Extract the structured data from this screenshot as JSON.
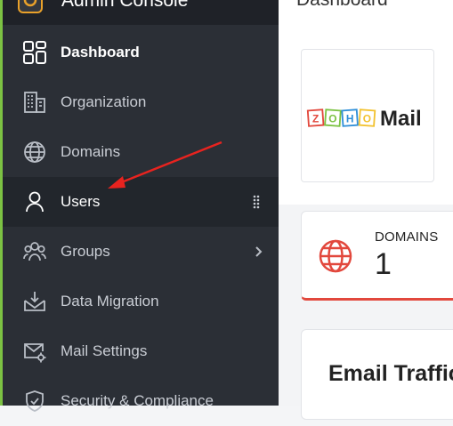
{
  "app": {
    "title": "Admin Console"
  },
  "header": {
    "title": "Dashboard"
  },
  "sidebar": {
    "items": [
      {
        "label": "Dashboard",
        "icon": "dashboard-icon",
        "active": true
      },
      {
        "label": "Organization",
        "icon": "building-icon"
      },
      {
        "label": "Domains",
        "icon": "globe-icon"
      },
      {
        "label": "Users",
        "icon": "user-icon",
        "hover": true
      },
      {
        "label": "Groups",
        "icon": "group-icon"
      },
      {
        "label": "Data Migration",
        "icon": "data-migration-icon"
      },
      {
        "label": "Mail Settings",
        "icon": "mail-settings-icon"
      },
      {
        "label": "Security & Compliance",
        "icon": "shield-icon"
      }
    ]
  },
  "product_logo": {
    "brand_letters": [
      "Z",
      "O",
      "H",
      "O"
    ],
    "product": "Mail"
  },
  "domains_card": {
    "label": "DOMAINS",
    "count": "1"
  },
  "email_traffic": {
    "title": "Email Traffic"
  },
  "colors": {
    "sidebar_bg": "#2b2f36",
    "accent_red": "#e2483d",
    "accent_green": "#7cc243"
  }
}
